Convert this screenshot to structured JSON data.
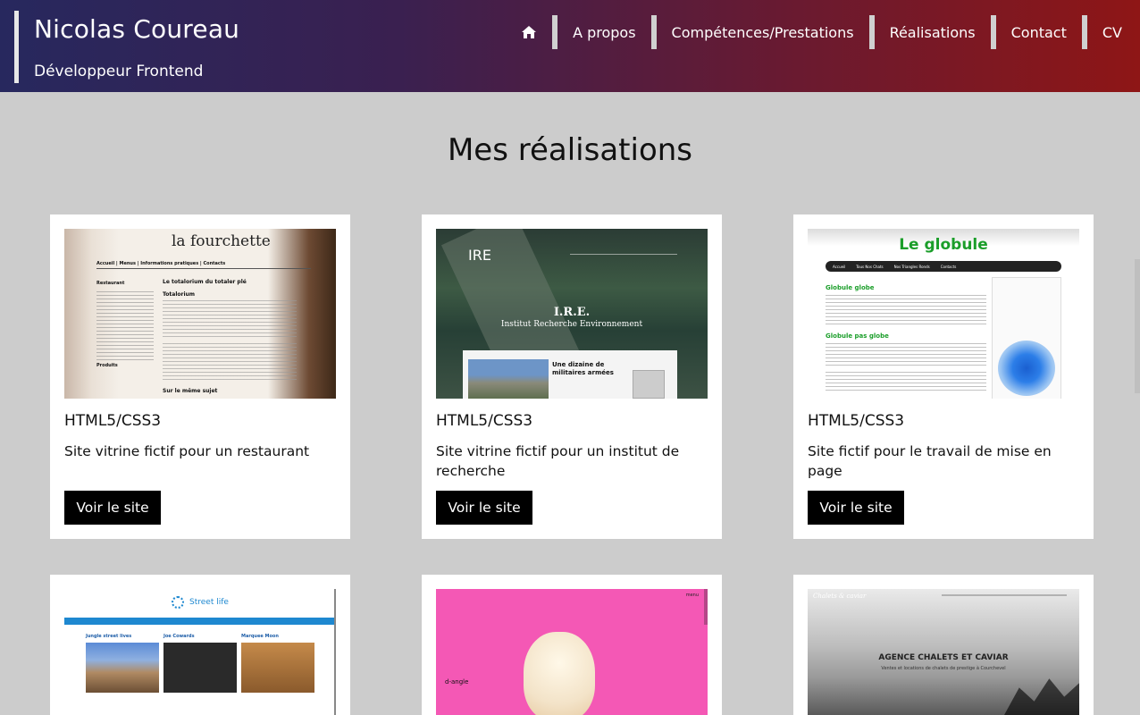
{
  "header": {
    "name": "Nicolas Coureau",
    "subtitle": "Développeur Frontend",
    "nav": {
      "home_icon": "home-icon",
      "items": [
        "A propos",
        "Compétences/Prestations",
        "Réalisations",
        "Contact",
        "CV"
      ]
    }
  },
  "main": {
    "title": "Mes réalisations",
    "cards": [
      {
        "tech": "HTML5/CSS3",
        "description": "Site vitrine fictif pour un restaurant",
        "button": "Voir le site",
        "thumb": {
          "logo": "la fourchette",
          "nav": "Accueil | Menus | Informations pratiques | Contacts",
          "h1": "Le totalorium du totaler plé",
          "h2": "Totalorium",
          "side": "Restaurant",
          "side2": "Produits",
          "foot": "Sur le même sujet"
        }
      },
      {
        "tech": "HTML5/CSS3",
        "description": "Site vitrine fictif pour un institut de recherche",
        "button": "Voir le site",
        "thumb": {
          "logo": "IRE",
          "title": "I.R.E.",
          "subtitle": "Institut Recherche Environnement",
          "article": "Une dizaine de militaires armées"
        }
      },
      {
        "tech": "HTML5/CSS3",
        "description": "Site fictif pour le travail de mise en page",
        "button": "Voir le site",
        "thumb": {
          "title": "Le globule",
          "nav": [
            "Accueil",
            "Tous Nos Chats",
            "Nos Triangles Ronds",
            "Contacts"
          ],
          "h1": "Globule globe",
          "h2": "Globule pas globe"
        }
      },
      {
        "thumb": {
          "title": "Street life",
          "cols": [
            "Jungle street lives",
            "Joe Cowards",
            "Marquee Moon"
          ]
        }
      },
      {
        "thumb": {
          "label": "d-angle",
          "menu": "menu"
        }
      },
      {
        "thumb": {
          "title": "AGENCE CHALETS ET CAVIAR",
          "subtitle": "Ventes et locations de chalets de prestige à Courchevel",
          "logo": "Chalets & caviar"
        }
      }
    ]
  },
  "colors": {
    "header_start": "#27285e",
    "header_end": "#8e1616",
    "page_bg": "#cccccc",
    "button_bg": "#000000"
  }
}
